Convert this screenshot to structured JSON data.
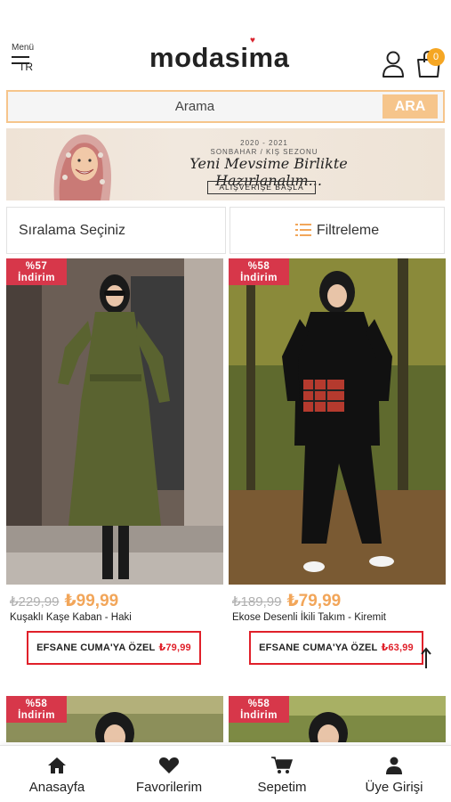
{
  "header": {
    "menu_label": "Menü",
    "language": "TR",
    "logo_text": "modasima",
    "cart_count": "0",
    "icons": [
      "menu-icon",
      "user-icon",
      "shopping-bag-icon"
    ]
  },
  "search": {
    "placeholder": "Arama",
    "button_label": "ARA"
  },
  "banner": {
    "years": "2020 - 2021",
    "season": "SONBAHAR / KIŞ SEZONU",
    "script_text": "Yeni Mevsime Birlikte Hazırlanalım...",
    "cta": "ALIŞVERİŞE BAŞLA"
  },
  "controls": {
    "sort_label": "Sıralama Seçiniz",
    "filter_label": "Filtreleme"
  },
  "products": [
    {
      "discount_pct": "%57",
      "discount_word": "İndirim",
      "old_price": "₺229,99",
      "new_price": "₺99,99",
      "name": "Kuşaklı Kaşe Kaban - Haki",
      "promo_label": "EFSANE CUMA'YA ÖZEL",
      "promo_price": "₺79,99"
    },
    {
      "discount_pct": "%58",
      "discount_word": "İndirim",
      "old_price": "₺189,99",
      "new_price": "₺79,99",
      "name": "Ekose Desenli İkili Takım - Kiremit",
      "promo_label": "EFSANE CUMA'YA ÖZEL",
      "promo_price": "₺63,99"
    },
    {
      "discount_pct": "%58",
      "discount_word": "İndirim"
    },
    {
      "discount_pct": "%58",
      "discount_word": "İndirim"
    }
  ],
  "bottom_nav": [
    {
      "label": "Anasayfa",
      "icon": "home-icon"
    },
    {
      "label": "Favorilerim",
      "icon": "heart-icon"
    },
    {
      "label": "Sepetim",
      "icon": "cart-icon"
    },
    {
      "label": "Üye Girişi",
      "icon": "user-icon"
    }
  ],
  "colors": {
    "accent": "#f6c58b",
    "price": "#f2a65a",
    "discount_badge": "#d7374a",
    "promo_border": "#e0202a",
    "cart_badge": "#f5a623"
  }
}
